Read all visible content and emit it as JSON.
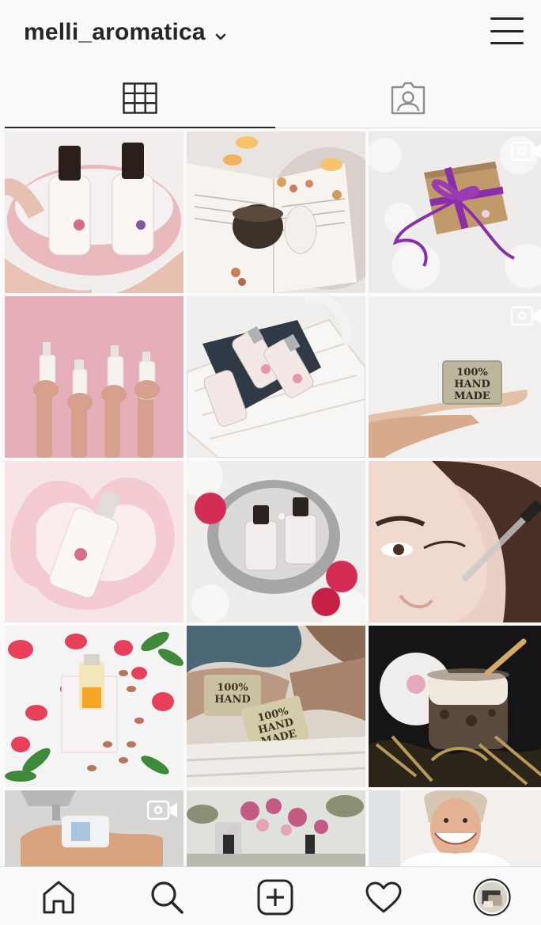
{
  "header": {
    "username": "melli_aromatica",
    "dropdown_icon": "chevron-down-icon",
    "menu_icon": "hamburger-menu-icon"
  },
  "tabs": [
    {
      "name": "posts-grid",
      "icon": "grid-icon",
      "active": true
    },
    {
      "name": "tagged",
      "icon": "tagged-person-icon",
      "active": false
    }
  ],
  "posts": [
    {
      "id": 1,
      "subject": "two dropper bottles in pink bowl",
      "is_video": false
    },
    {
      "id": 2,
      "subject": "open book with scrub jar and candles",
      "is_video": false
    },
    {
      "id": 3,
      "subject": "kraft gift box with purple ribbon",
      "is_video": true
    },
    {
      "id": 4,
      "subject": "hands holding bottles on pink",
      "is_video": false
    },
    {
      "id": 5,
      "subject": "white basket with bottles",
      "is_video": false
    },
    {
      "id": 6,
      "subject": "handmade soap on palm",
      "is_video": true
    },
    {
      "id": 7,
      "subject": "bottle in milk splash",
      "is_video": false
    },
    {
      "id": 8,
      "subject": "dropper bottles in stone bowl with roses",
      "is_video": false
    },
    {
      "id": 9,
      "subject": "face with serum dropper",
      "is_video": false
    },
    {
      "id": 10,
      "subject": "serum bottle with petals and almonds",
      "is_video": false
    },
    {
      "id": 11,
      "subject": "handmade soaps on towels",
      "is_video": false
    },
    {
      "id": 12,
      "subject": "scrub jar with gold ribbon",
      "is_video": false
    },
    {
      "id": 13,
      "subject": "washing hands with soap",
      "is_video": true
    },
    {
      "id": 14,
      "subject": "flowers and bottles",
      "is_video": false
    },
    {
      "id": 15,
      "subject": "smiling woman portrait",
      "is_video": false
    }
  ],
  "soap_text": {
    "line1": "100%",
    "line2": "HAND",
    "line3": "MADE"
  },
  "bottom_nav": [
    {
      "name": "home",
      "icon": "home-icon"
    },
    {
      "name": "search",
      "icon": "search-icon"
    },
    {
      "name": "new-post",
      "icon": "add-post-icon"
    },
    {
      "name": "activity",
      "icon": "heart-icon"
    },
    {
      "name": "profile",
      "icon": "profile-avatar-icon"
    }
  ],
  "colors": {
    "text": "#262626",
    "background": "#fafafa",
    "divider": "#dbdbdb",
    "accent_pink": "#e8a7b3",
    "accent_purple": "#8b2fa8"
  }
}
